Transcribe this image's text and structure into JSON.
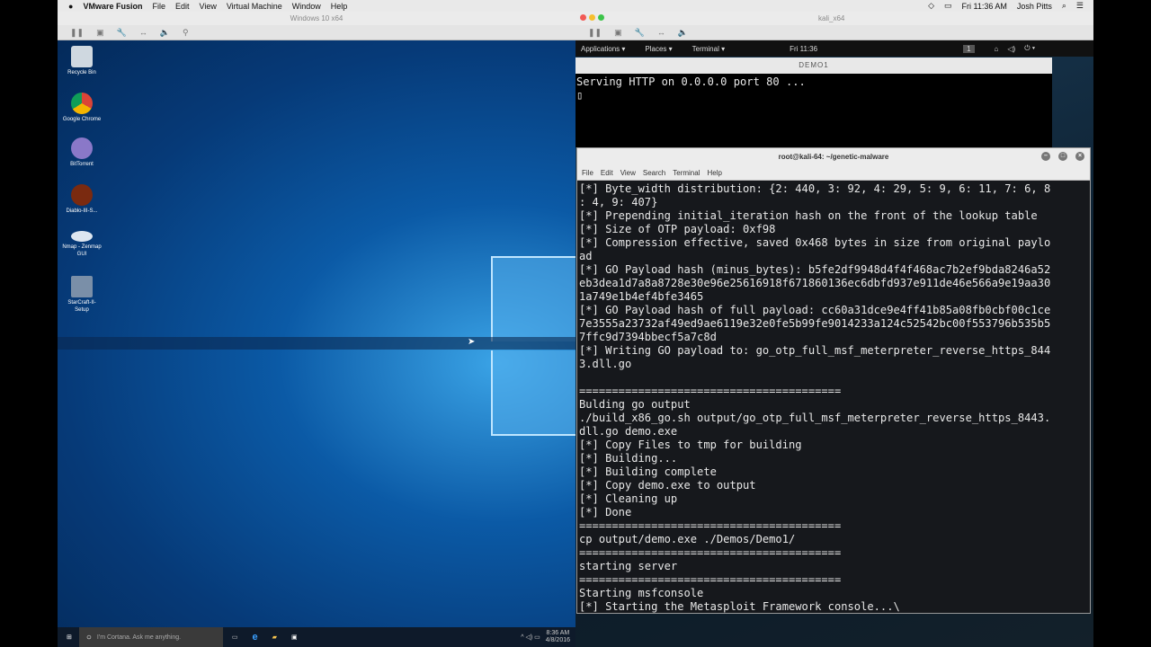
{
  "mac_menu": {
    "app": "VMware Fusion",
    "items": [
      "File",
      "Edit",
      "View",
      "Virtual Machine",
      "Window",
      "Help"
    ],
    "clock": "Fri 11:36 AM",
    "user": "Josh Pitts"
  },
  "vm_left": {
    "title": "Windows 10 x64"
  },
  "vm_right": {
    "title": "kali_x64"
  },
  "desktop_icons": [
    {
      "label": "Recycle Bin",
      "color": "#cfd8e0"
    },
    {
      "label": "Google Chrome",
      "color": "#db4437"
    },
    {
      "label": "BitTorrent",
      "color": "#8a78c8"
    },
    {
      "label": "Diablo-III-S...",
      "color": "#7a2a10"
    },
    {
      "label": "Nmap - Zenmap GUI",
      "color": "#dde6f0"
    },
    {
      "label": "StarCraft-II-Setup",
      "color": "#7a8fa8"
    }
  ],
  "taskbar": {
    "cortana": "I'm Cortana. Ask me anything.",
    "time": "8:36 AM",
    "date": "4/8/2016"
  },
  "gnome": {
    "applications": "Applications ▾",
    "places": "Places ▾",
    "terminal": "Terminal ▾",
    "clock": "Fri 11:36",
    "workspace": "1"
  },
  "demo1": {
    "title": "DEMO1",
    "output": "Serving HTTP on 0.0.0.0 port 80 ...\n▯"
  },
  "terminal": {
    "title": "root@kali-64: ~/genetic-malware",
    "menu": [
      "File",
      "Edit",
      "View",
      "Search",
      "Terminal",
      "Help"
    ],
    "output": "[*] Byte_width distribution: {2: 440, 3: 92, 4: 29, 5: 9, 6: 11, 7: 6, 8\n: 4, 9: 407}\n[*] Prepending initial_iteration hash on the front of the lookup table\n[*] Size of OTP payload: 0xf98\n[*] Compression effective, saved 0x468 bytes in size from original paylo\nad\n[*] GO Payload hash (minus_bytes): b5fe2df9948d4f4f468ac7b2ef9bda8246a52\neb3dea1d7a8a8728e30e96e25616918f671860136ec6dbfd937e911de46e566a9e19aa30\n1a749e1b4ef4bfe3465\n[*] GO Payload hash of full payload: cc60a31dce9e4ff41b85a08fb0cbf00c1ce\n7e3555a23732af49ed9ae6119e32e0fe5b99fe9014233a124c52542bc00f553796b535b5\n7ffc9d7394bbecf5a7c8d\n[*] Writing GO payload to: go_otp_full_msf_meterpreter_reverse_https_844\n3.dll.go\n\n========================================\nBulding go output\n./build_x86_go.sh output/go_otp_full_msf_meterpreter_reverse_https_8443.\ndll.go demo.exe\n[*] Copy Files to tmp for building\n[*] Building...\n[*] Building complete\n[*] Copy demo.exe to output\n[*] Cleaning up\n[*] Done\n========================================\ncp output/demo.exe ./Demos/Demo1/\n========================================\nstarting server\n========================================\nStarting msfconsole\n[*] Starting the Metasploit Framework console...\\"
  }
}
